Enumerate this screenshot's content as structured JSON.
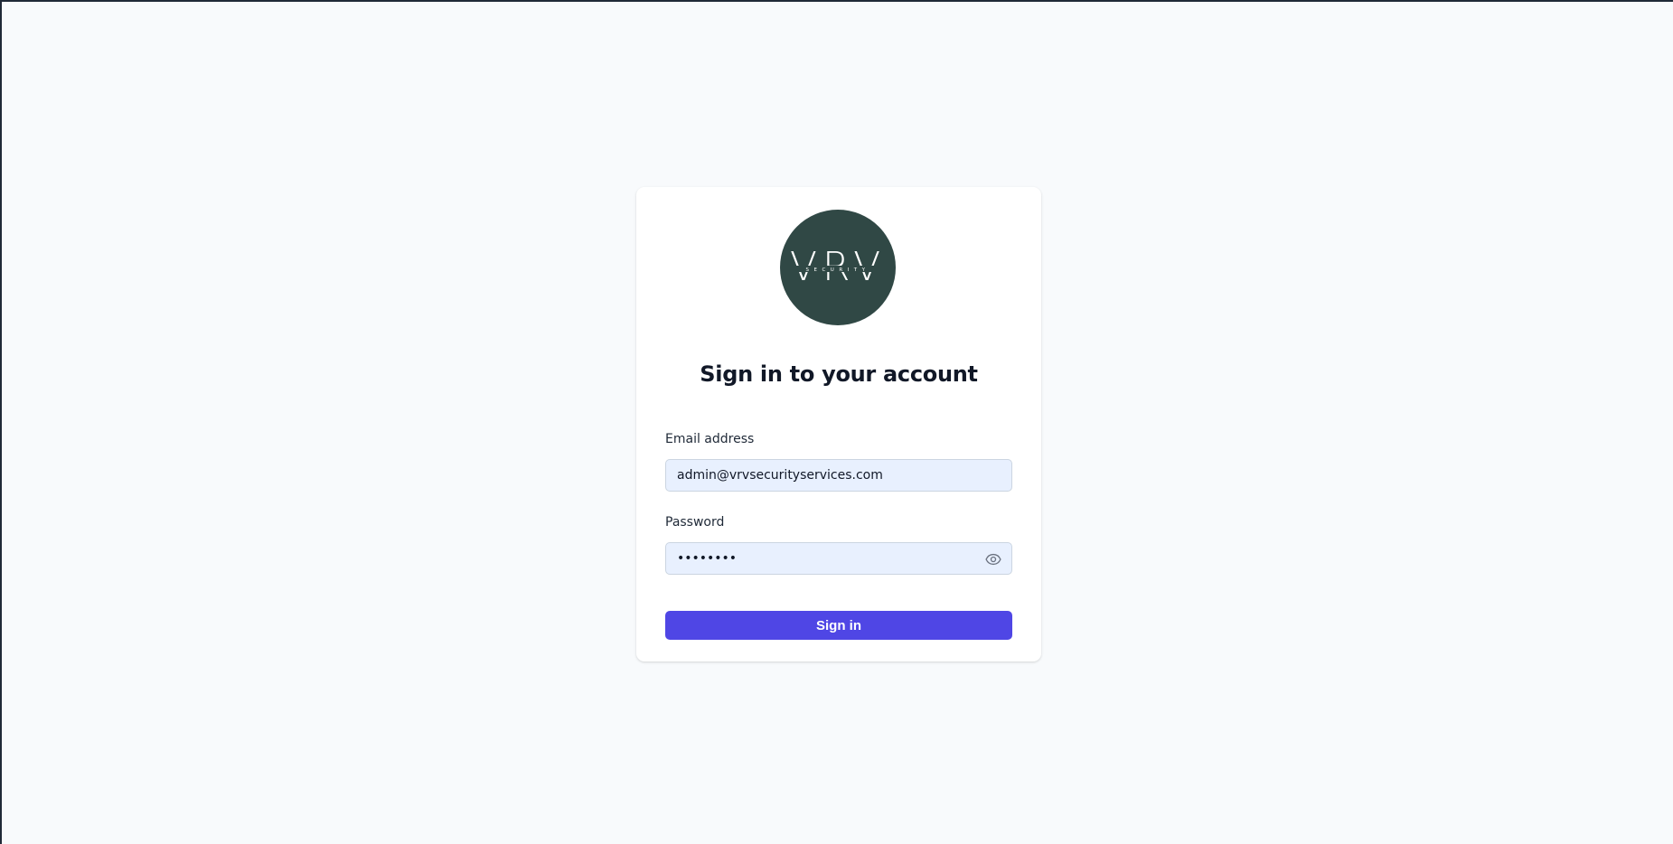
{
  "logo": {
    "text": "VRV",
    "subtext": "SECURITY",
    "background": "#304845"
  },
  "form": {
    "title": "Sign in to your account",
    "email_label": "Email address",
    "email_value": "admin@vrvsecurityservices.com",
    "password_label": "Password",
    "password_value": "password",
    "password_toggle_icon": "eye-icon",
    "submit_label": "Sign in",
    "accent_color": "#4f46e5"
  }
}
